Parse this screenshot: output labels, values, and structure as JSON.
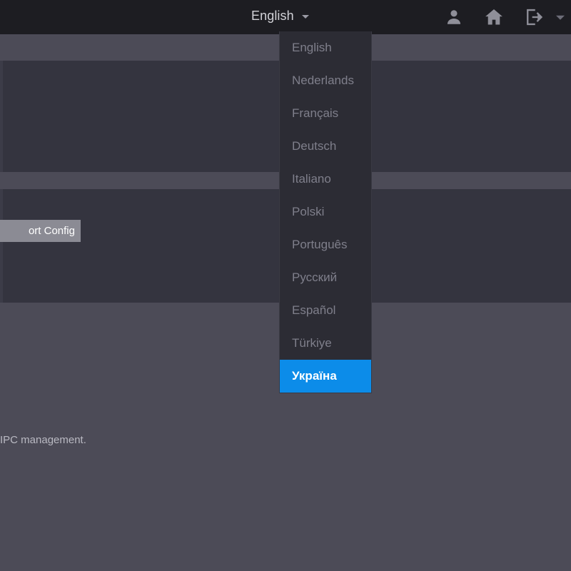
{
  "header": {
    "language_selector": {
      "label": "English",
      "caret_icon": "chevron-down-icon"
    },
    "icons": [
      {
        "name": "user-icon",
        "label": "User"
      },
      {
        "name": "home-icon",
        "label": "Home"
      },
      {
        "name": "logout-icon",
        "label": "Logout"
      }
    ]
  },
  "language_dropdown": {
    "options": [
      {
        "label": "English",
        "selected": false
      },
      {
        "label": "Nederlands",
        "selected": false
      },
      {
        "label": "Français",
        "selected": false
      },
      {
        "label": "Deutsch",
        "selected": false
      },
      {
        "label": "Italiano",
        "selected": false
      },
      {
        "label": "Polski",
        "selected": false
      },
      {
        "label": "Português",
        "selected": false
      },
      {
        "label": "Русский",
        "selected": false
      },
      {
        "label": "Español",
        "selected": false
      },
      {
        "label": "Türkiye",
        "selected": false
      },
      {
        "label": "Україна",
        "selected": true
      }
    ]
  },
  "content": {
    "config_button_label": "ort Config",
    "hint_text": "IPC management."
  },
  "colors": {
    "header_bg": "#1d1d22",
    "panel_dark": "#34343f",
    "panel_light": "#4c4b57",
    "dropdown_bg": "#2c2c34",
    "accent_blue": "#0c8ce9",
    "button_gray": "#8b8b94",
    "text_muted": "#7f7f8b",
    "text_light": "#d2d2d8"
  }
}
